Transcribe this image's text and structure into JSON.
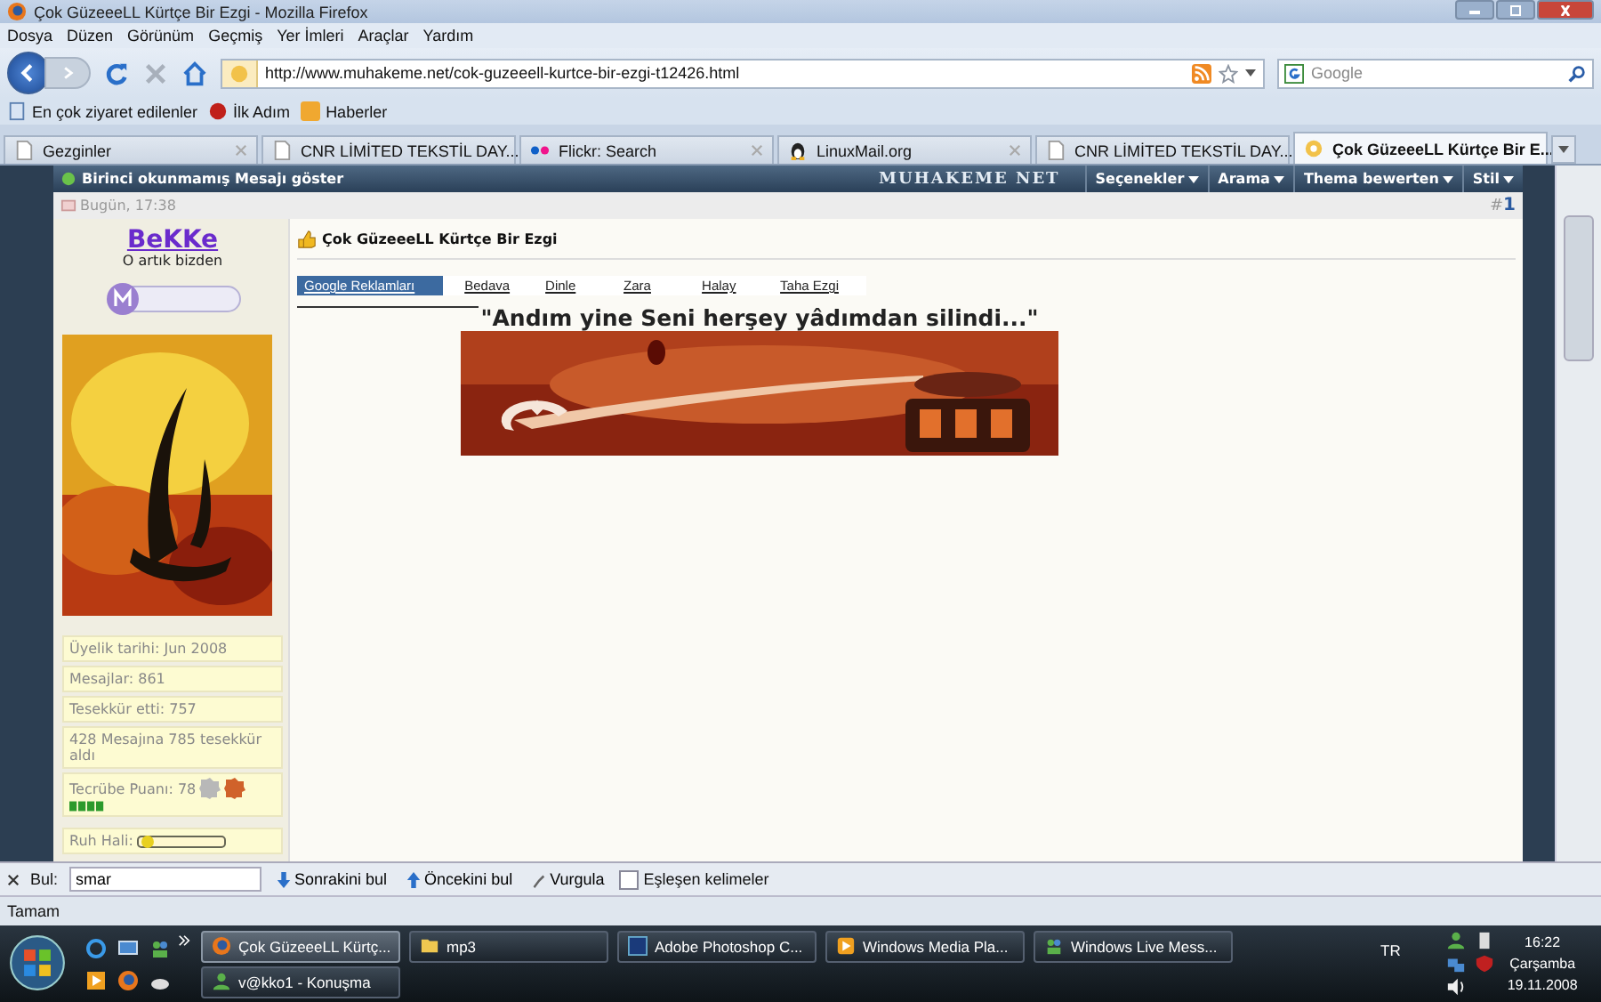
{
  "window": {
    "title": "Çok GüzeeeLL Kürtçe Bir Ezgi - Mozilla Firefox"
  },
  "menu": [
    "Dosya",
    "Düzen",
    "Görünüm",
    "Geçmiş",
    "Yer İmleri",
    "Araçlar",
    "Yardım"
  ],
  "nav": {
    "url": "http://www.muhakeme.net/cok-guzeeell-kurtce-bir-ezgi-t12426.html",
    "search_placeholder": "Google"
  },
  "bookmarks": [
    "En çok ziyaret edilenler",
    "İlk Adım",
    "Haberler"
  ],
  "tabs": [
    {
      "label": "Gezginler",
      "selected": false,
      "kind": "page"
    },
    {
      "label": "CNR LİMİTED TEKSTİL DAY...",
      "selected": false,
      "kind": "page"
    },
    {
      "label": "Flickr: Search",
      "selected": false,
      "kind": "flickr"
    },
    {
      "label": "LinuxMail.org",
      "selected": false,
      "kind": "penguin"
    },
    {
      "label": "CNR LİMİTED TEKSTİL DAY...",
      "selected": false,
      "kind": "page"
    },
    {
      "label": "Çok GüzeeeLL Kürtçe Bir E...",
      "selected": true,
      "kind": "site"
    }
  ],
  "forum": {
    "header_link": "Birinci okunmamış Mesajı göster",
    "logo": "MUHAKEME NET",
    "menus": [
      "Seçenekler",
      "Arama",
      "Thema bewerten",
      "Stil"
    ]
  },
  "post": {
    "date": "Bugün, 17:38",
    "number_prefix": "#",
    "number": "1",
    "user": {
      "name": "BeKKe",
      "title": "O artık bizden"
    },
    "stats": [
      "Üyelik tarihi: Jun 2008",
      "Mesajlar: 861",
      "Tesekkür etti: 757",
      "428 Mesajına 785 tesekkür aldı"
    ],
    "experience": "Tecrübe Puanı: 78",
    "mood": "Ruh Hali:",
    "title": "Çok GüzeeeLL Kürtçe Bir Ezgi",
    "ad_links": [
      {
        "label": "Google Reklamları",
        "selected": true
      },
      {
        "label": "Bedava",
        "selected": false
      },
      {
        "label": "Dinle",
        "selected": false
      },
      {
        "label": "Zara",
        "selected": false
      },
      {
        "label": "Halay",
        "selected": false
      },
      {
        "label": "Taha Ezgi",
        "selected": false
      }
    ],
    "quote": "\"Andım yine Seni herşey yâdımdan silindi...\""
  },
  "find_bar": {
    "label": "Bul:",
    "value": "smar",
    "next": "Sonrakini bul",
    "prev": "Öncekini bul",
    "highlight": "Vurgula",
    "match_case": {
      "label": "Eşleşen kelimeler",
      "checked": false
    }
  },
  "status": "Tamam",
  "taskbar": {
    "buttons": [
      {
        "label": "Çok GüzeeeLL Kürtç...",
        "selected": true,
        "kind": "firefox"
      },
      {
        "label": "mp3",
        "selected": false,
        "kind": "folder"
      },
      {
        "label": "Adobe Photoshop C...",
        "selected": false,
        "kind": "photoshop"
      },
      {
        "label": "Windows Media Pla...",
        "selected": false,
        "kind": "media"
      },
      {
        "label": "Windows Live Mess...",
        "selected": false,
        "kind": "messenger"
      },
      {
        "label": "v@kko1 - Konuşma",
        "selected": false,
        "kind": "chat"
      }
    ],
    "lang": "TR",
    "clock": {
      "time": "16:22",
      "day": "Çarşamba",
      "date": "19.11.2008"
    }
  }
}
